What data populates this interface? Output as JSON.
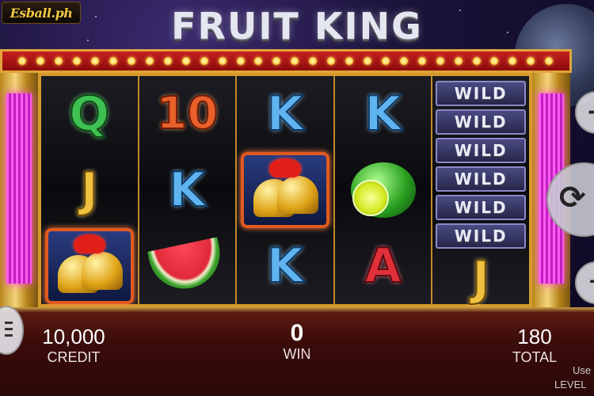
{
  "logo": {
    "text": "Esball.ph"
  },
  "game_title": "FRUIT KING",
  "reels": [
    [
      "Q",
      "J",
      "BELL"
    ],
    [
      "10",
      "K",
      "WATERMELON"
    ],
    [
      "K",
      "BELL",
      "K"
    ],
    [
      "K",
      "LEMON",
      "A"
    ],
    [
      "WILD",
      "J"
    ]
  ],
  "wild_label": "WILD",
  "wild_count": 6,
  "symbols": {
    "q": "Q",
    "ten": "10",
    "k": "K",
    "j": "J",
    "a": "A"
  },
  "stats": {
    "credit_value": "10,000",
    "credit_label": "CREDIT",
    "win_value": "0",
    "win_label": "WIN",
    "total_value": "180",
    "total_label": "TOTAL"
  },
  "side_labels": {
    "use": "Use",
    "level": "LEVEL"
  },
  "controls": {
    "icons": [
      "minus-icon",
      "spin-icon",
      "plus-icon",
      "menu-icon"
    ]
  },
  "colors": {
    "marquee": "#c62020",
    "frame": "#d69a2c",
    "neon": "#ff5cf0"
  }
}
